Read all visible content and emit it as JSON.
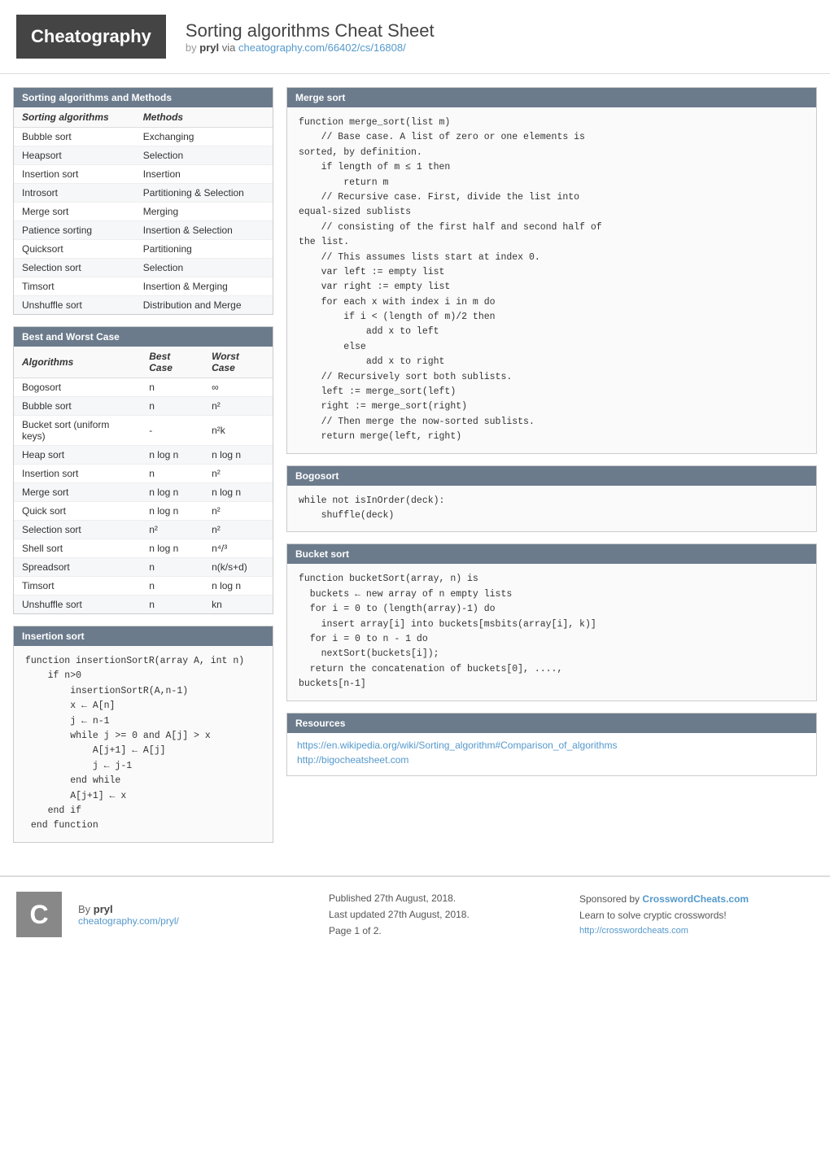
{
  "header": {
    "logo_text": "Cheatography",
    "title": "Sorting algorithms Cheat Sheet",
    "by_label": "by",
    "author": "pryl",
    "via_label": "via",
    "url": "cheatography.com/66402/cs/16808/"
  },
  "sorting_algorithms_section": {
    "title": "Sorting algorithms and Methods",
    "col1_header": "Sorting algorithms",
    "col2_header": "Methods",
    "rows": [
      {
        "algorithm": "Bubble sort",
        "method": "Exchanging"
      },
      {
        "algorithm": "Heapsort",
        "method": "Selection"
      },
      {
        "algorithm": "Insertion sort",
        "method": "Insertion"
      },
      {
        "algorithm": "Introsort",
        "method": "Partitioning & Selection"
      },
      {
        "algorithm": "Merge sort",
        "method": "Merging"
      },
      {
        "algorithm": "Patience sorting",
        "method": "Insertion & Selection"
      },
      {
        "algorithm": "Quicksort",
        "method": "Partitioning"
      },
      {
        "algorithm": "Selection sort",
        "method": "Selection"
      },
      {
        "algorithm": "Timsort",
        "method": "Insertion & Merging"
      },
      {
        "algorithm": "Unshuffle sort",
        "method": "Distribution and Merge"
      }
    ]
  },
  "best_worst_section": {
    "title": "Best and Worst Case",
    "col1_header": "Algorithms",
    "col2_header": "Best Case",
    "col3_header": "Worst Case",
    "rows": [
      {
        "algorithm": "Bogosort",
        "best": "n",
        "worst": "∞"
      },
      {
        "algorithm": "Bubble sort",
        "best": "n",
        "worst": "n²"
      },
      {
        "algorithm": "Bucket sort (uniform keys)",
        "best": "-",
        "worst": "n²k"
      },
      {
        "algorithm": "Heap sort",
        "best": "n log n",
        "worst": "n log n"
      },
      {
        "algorithm": "Insertion sort",
        "best": "n",
        "worst": "n²"
      },
      {
        "algorithm": "Merge sort",
        "best": "n log n",
        "worst": "n log n"
      },
      {
        "algorithm": "Quick sort",
        "best": "n log n",
        "worst": "n²"
      },
      {
        "algorithm": "Selection sort",
        "best": "n²",
        "worst": "n²"
      },
      {
        "algorithm": "Shell sort",
        "best": "n log n",
        "worst": "n⁴/³"
      },
      {
        "algorithm": "Spreadsort",
        "best": "n",
        "worst": "n(k/s+d)"
      },
      {
        "algorithm": "Timsort",
        "best": "n",
        "worst": "n log n"
      },
      {
        "algorithm": "Unshuffle sort",
        "best": "n",
        "worst": "kn"
      }
    ]
  },
  "insertion_sort_section": {
    "title": "Insertion sort",
    "code": "function insertionSortR(array A, int n)\n    if n>0\n        insertionSortR(A,n-1)\n        x ← A[n]\n        j ← n-1\n        while j >= 0 and A[j] > x\n            A[j+1] ← A[j]\n            j ← j-1\n        end while\n        A[j+1] ← x\n    end if\n end function"
  },
  "merge_sort_section": {
    "title": "Merge sort",
    "code": "function merge_sort(list m)\n    // Base case. A list of zero or one elements is\nsorted, by definition.\n    if length of m ≤ 1 then\n        return m\n    // Recursive case. First, divide the list into\nequal-sized sublists\n    // consisting of the first half and second half of\nthe list.\n    // This assumes lists start at index 0.\n    var left := empty list\n    var right := empty list\n    for each x with index i in m do\n        if i < (length of m)/2 then\n            add x to left\n        else\n            add x to right\n    // Recursively sort both sublists.\n    left := merge_sort(left)\n    right := merge_sort(right)\n    // Then merge the now-sorted sublists.\n    return merge(left, right)"
  },
  "bogosort_section": {
    "title": "Bogosort",
    "code": "while not isInOrder(deck):\n    shuffle(deck)"
  },
  "bucket_sort_section": {
    "title": "Bucket sort",
    "code": "function bucketSort(array, n) is\n  buckets ← new array of n empty lists\n  for i = 0 to (length(array)-1) do\n    insert array[i] into buckets[msbits(array[i], k)]\n  for i = 0 to n - 1 do\n    nextSort(buckets[i]);\n  return the concatenation of buckets[0], ....,\nbuckets[n-1]"
  },
  "resources_section": {
    "title": "Resources",
    "links": [
      "https://en.wikipedia.org/wiki/Sorting_algorithm#Comparison_of_algorithms",
      "http://bigocheatsheet.com"
    ]
  },
  "footer": {
    "logo_letter": "C",
    "by_label": "By",
    "author": "pryl",
    "author_url": "cheatography.com/pryl/",
    "published": "Published 27th August, 2018.",
    "updated": "Last updated 27th August, 2018.",
    "page": "Page 1 of 2.",
    "sponsored_by": "Sponsored by",
    "sponsor_name": "CrosswordCheats.com",
    "sponsor_tagline": "Learn to solve cryptic crosswords!",
    "sponsor_url": "http://crosswordcheats.com"
  }
}
